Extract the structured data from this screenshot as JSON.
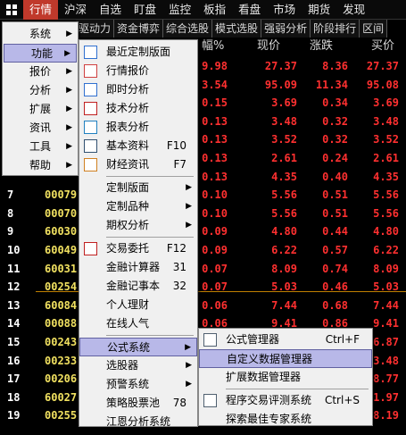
{
  "topnav": {
    "items": [
      "行情",
      "沪深",
      "自选",
      "盯盘",
      "监控",
      "板指",
      "看盘",
      "市场",
      "期货",
      "发现"
    ]
  },
  "subtabs": [
    "驱动力",
    "资金博弈",
    "综合选股",
    "模式选股",
    "强弱分析",
    "阶段排行",
    "区间"
  ],
  "header": {
    "pct_partial": "幅%",
    "price": "现价",
    "change": "涨跌",
    "buy": "买价"
  },
  "rows": [
    {
      "idx": "",
      "code": "",
      "v1": "9.98",
      "v2": "27.37",
      "v3": "8.36",
      "v4": "27.37"
    },
    {
      "idx": "",
      "code": "",
      "v1": "3.54",
      "v2": "95.09",
      "v3": "11.34",
      "v4": "95.08"
    },
    {
      "idx": "",
      "code": "",
      "v1": "0.15",
      "v2": "3.69",
      "v3": "0.34",
      "v4": "3.69"
    },
    {
      "idx": "",
      "code": "",
      "v1": "0.13",
      "v2": "3.48",
      "v3": "0.32",
      "v4": "3.48"
    },
    {
      "idx": "",
      "code": "",
      "v1": "0.13",
      "v2": "3.52",
      "v3": "0.32",
      "v4": "3.52"
    },
    {
      "idx": "",
      "code": "",
      "v1": "0.13",
      "v2": "2.61",
      "v3": "0.24",
      "v4": "2.61"
    },
    {
      "idx": "",
      "code": "",
      "v1": "0.13",
      "v2": "4.35",
      "v3": "0.40",
      "v4": "4.35"
    },
    {
      "idx": "7",
      "code": "00079",
      "v1": "0.10",
      "v2": "5.56",
      "v3": "0.51",
      "v4": "5.56"
    },
    {
      "idx": "8",
      "code": "00070",
      "v1": "0.10",
      "v2": "5.56",
      "v3": "0.51",
      "v4": "5.56"
    },
    {
      "idx": "9",
      "code": "60030",
      "v1": "0.09",
      "v2": "4.80",
      "v3": "0.44",
      "v4": "4.80"
    },
    {
      "idx": "10",
      "code": "60049",
      "v1": "0.09",
      "v2": "6.22",
      "v3": "0.57",
      "v4": "6.22"
    },
    {
      "idx": "11",
      "code": "60031",
      "v1": "0.07",
      "v2": "8.09",
      "v3": "0.74",
      "v4": "8.09"
    },
    {
      "idx": "12",
      "code": "00254",
      "v1": "0.07",
      "v2": "5.03",
      "v3": "0.46",
      "v4": "5.03"
    },
    {
      "idx": "13",
      "code": "60084",
      "v1": "0.06",
      "v2": "7.44",
      "v3": "0.68",
      "v4": "7.44"
    },
    {
      "idx": "14",
      "code": "00088",
      "v1": "0.06",
      "v2": "9.41",
      "v3": "0.86",
      "v4": "9.41"
    },
    {
      "idx": "15",
      "code": "00243",
      "v1": "",
      "v2": "",
      "v3": "",
      "v4": "6.87"
    },
    {
      "idx": "16",
      "code": "00233",
      "v1": "",
      "v2": "",
      "v3": "",
      "v4": "3.48"
    },
    {
      "idx": "17",
      "code": "00206",
      "v1": "",
      "v2": "",
      "v3": "",
      "v4": "8.77"
    },
    {
      "idx": "18",
      "code": "60027",
      "v1": "",
      "v2": "",
      "v3": "",
      "v4": "11.97"
    },
    {
      "idx": "19",
      "code": "00255",
      "v1": "",
      "v2": "",
      "v3": "",
      "v4": "8.19"
    }
  ],
  "menu1": {
    "items": [
      {
        "label": "系统",
        "arrow": "▶"
      },
      {
        "label": "功能",
        "arrow": "▶"
      },
      {
        "label": "报价",
        "arrow": "▶"
      },
      {
        "label": "分析",
        "arrow": "▶"
      },
      {
        "label": "扩展",
        "arrow": "▶"
      },
      {
        "label": "资讯",
        "arrow": "▶"
      },
      {
        "label": "工具",
        "arrow": "▶"
      },
      {
        "label": "帮助",
        "arrow": "▶"
      }
    ]
  },
  "menu2": {
    "items": [
      {
        "label": "最近定制版面",
        "shortcut": "",
        "arrow": ""
      },
      {
        "label": "行情报价",
        "shortcut": "",
        "arrow": ""
      },
      {
        "label": "即时分析",
        "shortcut": "",
        "arrow": ""
      },
      {
        "label": "技术分析",
        "shortcut": "",
        "arrow": ""
      },
      {
        "label": "报表分析",
        "shortcut": "",
        "arrow": ""
      },
      {
        "label": "基本资料",
        "shortcut": "F10",
        "arrow": ""
      },
      {
        "label": "财经资讯",
        "shortcut": "F7",
        "arrow": ""
      },
      {
        "label": "定制版面",
        "shortcut": "",
        "arrow": "▶"
      },
      {
        "label": "定制品种",
        "shortcut": "",
        "arrow": "▶"
      },
      {
        "label": "期权分析",
        "shortcut": "",
        "arrow": "▶"
      },
      {
        "label": "交易委托",
        "shortcut": "F12",
        "arrow": ""
      },
      {
        "label": "金融计算器",
        "shortcut": "31",
        "arrow": ""
      },
      {
        "label": "金融记事本",
        "shortcut": "32",
        "arrow": ""
      },
      {
        "label": "个人理财",
        "shortcut": "",
        "arrow": ""
      },
      {
        "label": "在线人气",
        "shortcut": "",
        "arrow": ""
      },
      {
        "label": "公式系统",
        "shortcut": "",
        "arrow": "▶"
      },
      {
        "label": "选股器",
        "shortcut": "",
        "arrow": "▶"
      },
      {
        "label": "预警系统",
        "shortcut": "",
        "arrow": "▶"
      },
      {
        "label": "策略股票池",
        "shortcut": "78",
        "arrow": ""
      },
      {
        "label": "江恩分析系统",
        "shortcut": "",
        "arrow": ""
      }
    ]
  },
  "menu3": {
    "items": [
      {
        "label": "公式管理器",
        "shortcut": "Ctrl+F"
      },
      {
        "label": "自定义数据管理器",
        "shortcut": ""
      },
      {
        "label": "扩展数据管理器",
        "shortcut": ""
      },
      {
        "label": "程序交易评测系统",
        "shortcut": "Ctrl+S"
      },
      {
        "label": "探索最佳专家系统",
        "shortcut": ""
      }
    ]
  },
  "colors": {
    "price_up": "#ff3030",
    "code": "#f0e060",
    "active_tab": "#c0392b",
    "menu_highlight": "#b8b8e8"
  }
}
